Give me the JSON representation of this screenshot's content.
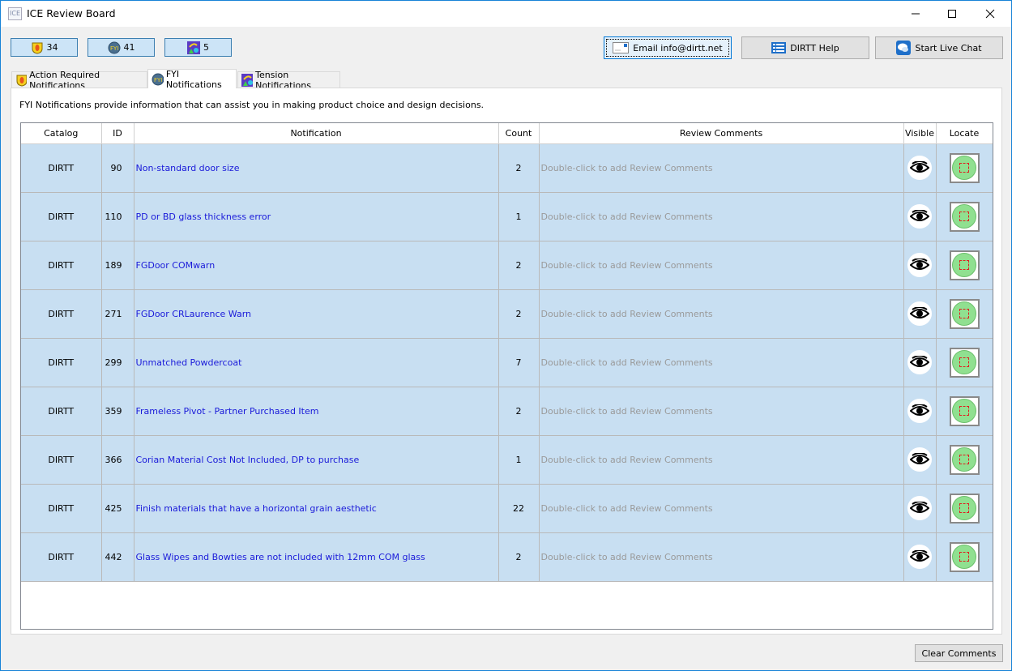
{
  "window": {
    "title": "ICE Review Board",
    "app_icon_label": "ICE"
  },
  "counters": [
    {
      "icon": "action-required-shield-icon",
      "value": "34"
    },
    {
      "icon": "fyi-globe-icon",
      "value": "41"
    },
    {
      "icon": "tension-shapes-icon",
      "value": "5"
    }
  ],
  "toolbar": {
    "email_label": "Email info@dirtt.net",
    "help_label": "DIRTT Help",
    "chat_label": "Start Live Chat"
  },
  "tabs": [
    {
      "label": "Action Required Notifications",
      "active": false
    },
    {
      "label": "FYI Notifications",
      "active": true
    },
    {
      "label": "Tension Notifications",
      "active": false
    }
  ],
  "description": "FYI Notifications provide information that can assist you in making product choice and design decisions.",
  "table": {
    "columns": [
      "Catalog",
      "ID",
      "Notification",
      "Count",
      "Review Comments",
      "Visible",
      "Locate"
    ],
    "comment_placeholder": "Double-click to add Review Comments",
    "rows": [
      {
        "catalog": "DIRTT",
        "id": "90",
        "notification": "Non-standard door size",
        "count": "2"
      },
      {
        "catalog": "DIRTT",
        "id": "110",
        "notification": "PD or BD glass thickness error",
        "count": "1"
      },
      {
        "catalog": "DIRTT",
        "id": "189",
        "notification": "FGDoor COMwarn",
        "count": "2"
      },
      {
        "catalog": "DIRTT",
        "id": "271",
        "notification": "FGDoor CRLaurence Warn",
        "count": "2"
      },
      {
        "catalog": "DIRTT",
        "id": "299",
        "notification": "Unmatched Powdercoat",
        "count": "7"
      },
      {
        "catalog": "DIRTT",
        "id": "359",
        "notification": "Frameless Pivot - Partner Purchased Item",
        "count": "2"
      },
      {
        "catalog": "DIRTT",
        "id": "366",
        "notification": "Corian Material Cost Not Included, DP to purchase",
        "count": "1"
      },
      {
        "catalog": "DIRTT",
        "id": "425",
        "notification": "Finish materials that have a horizontal grain aesthetic",
        "count": "22"
      },
      {
        "catalog": "DIRTT",
        "id": "442",
        "notification": "Glass Wipes and Bowties are not included with 12mm COM glass",
        "count": "2"
      }
    ]
  },
  "footer": {
    "clear_label": "Clear Comments"
  }
}
